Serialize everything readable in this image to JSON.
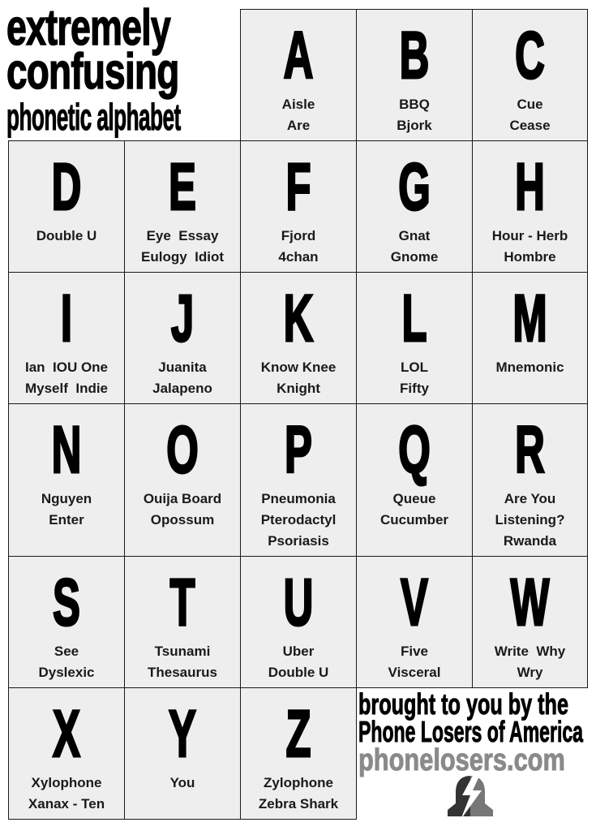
{
  "title": {
    "line1": "extremely",
    "line2": "confusing",
    "line3": "phonetic alphabet"
  },
  "cells": [
    {
      "letter": "A",
      "words": [
        "Aisle",
        "Are"
      ]
    },
    {
      "letter": "B",
      "words": [
        "BBQ",
        "Bjork"
      ]
    },
    {
      "letter": "C",
      "words": [
        "Cue",
        "Cease"
      ]
    },
    {
      "letter": "D",
      "words": [
        "Double U"
      ]
    },
    {
      "letter": "E",
      "words": [
        "Eye  Essay",
        "Eulogy  Idiot"
      ]
    },
    {
      "letter": "F",
      "words": [
        "Fjord",
        "4chan"
      ]
    },
    {
      "letter": "G",
      "words": [
        "Gnat",
        "Gnome"
      ]
    },
    {
      "letter": "H",
      "words": [
        "Hour - Herb",
        "Hombre"
      ]
    },
    {
      "letter": "I",
      "words": [
        "Ian  IOU One",
        "Myself  Indie"
      ]
    },
    {
      "letter": "J",
      "words": [
        "Juanita",
        "Jalapeno"
      ]
    },
    {
      "letter": "K",
      "words": [
        "Know Knee",
        "Knight"
      ]
    },
    {
      "letter": "L",
      "words": [
        "LOL",
        "Fifty"
      ]
    },
    {
      "letter": "M",
      "words": [
        "Mnemonic"
      ]
    },
    {
      "letter": "N",
      "words": [
        "Nguyen",
        "Enter"
      ]
    },
    {
      "letter": "O",
      "words": [
        "Ouija Board",
        "Opossum"
      ]
    },
    {
      "letter": "P",
      "words": [
        "Pneumonia",
        "Pterodactyl",
        "Psoriasis"
      ]
    },
    {
      "letter": "Q",
      "words": [
        "Queue",
        "Cucumber"
      ]
    },
    {
      "letter": "R",
      "words": [
        "Are You",
        "Listening?",
        "Rwanda"
      ]
    },
    {
      "letter": "S",
      "words": [
        "See",
        "Dyslexic"
      ]
    },
    {
      "letter": "T",
      "words": [
        "Tsunami",
        "Thesaurus"
      ]
    },
    {
      "letter": "U",
      "words": [
        "Uber",
        "Double U"
      ]
    },
    {
      "letter": "V",
      "words": [
        "Five",
        "Visceral"
      ]
    },
    {
      "letter": "W",
      "words": [
        "Write  Why",
        "Wry"
      ]
    },
    {
      "letter": "X",
      "words": [
        "Xylophone",
        "Xanax - Ten"
      ]
    },
    {
      "letter": "Y",
      "words": [
        "You"
      ]
    },
    {
      "letter": "Z",
      "words": [
        "Zylophone",
        "Zebra Shark"
      ]
    }
  ],
  "footer": {
    "line1": "brought to you by the",
    "line2": "Phone Losers of America",
    "line3": "phonelosers.com",
    "logo_icon": "bell-lightning-icon"
  },
  "colors": {
    "cell_bg": "#eeeeee",
    "border": "#1a1a1a",
    "text": "#000000",
    "url_gray": "#8a8a8a",
    "logo_dark": "#333333",
    "logo_light": "#777777"
  }
}
